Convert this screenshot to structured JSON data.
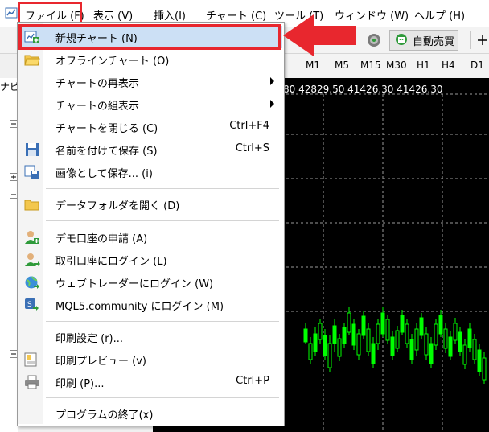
{
  "menubar": {
    "items": [
      "ファイル (F)",
      "表示 (V)",
      "挿入(I)",
      "チャート (C)",
      "ツール (T)",
      "ウィンドウ (W)",
      "ヘルプ (H)"
    ]
  },
  "toolbar": {
    "autotrade_label": "自動売買"
  },
  "timeframes": [
    "M1",
    "M5",
    "M15",
    "M30",
    "H1",
    "H4",
    "D1"
  ],
  "panel_title": "ナビ",
  "chart": {
    "price_text": "80 42829.50 41426.30 41426.30"
  },
  "dropdown": {
    "items": [
      {
        "label": "新規チャート (N)",
        "icon": "new-chart-icon",
        "shortcut": ""
      },
      {
        "label": "オフラインチャート (O)",
        "icon": "open-folder-icon",
        "shortcut": ""
      },
      {
        "label": "チャートの再表示",
        "icon": "",
        "shortcut": "",
        "submenu": true
      },
      {
        "label": "チャートの組表示",
        "icon": "",
        "shortcut": "",
        "submenu": true
      },
      {
        "label": "チャートを閉じる (C)",
        "icon": "",
        "shortcut": "Ctrl+F4"
      },
      {
        "label": "名前を付けて保存 (S)",
        "icon": "save-icon",
        "shortcut": "Ctrl+S"
      },
      {
        "label": "画像として保存... (i)",
        "icon": "save-picture-icon",
        "shortcut": ""
      },
      {
        "label": "データフォルダを開く (D)",
        "icon": "folder-icon",
        "shortcut": ""
      },
      {
        "label": "デモ口座の申請 (A)",
        "icon": "add-account-icon",
        "shortcut": ""
      },
      {
        "label": "取引口座にログイン (L)",
        "icon": "login-account-icon",
        "shortcut": ""
      },
      {
        "label": "ウェブトレーダーにログイン (W)",
        "icon": "web-trader-icon",
        "shortcut": ""
      },
      {
        "label": "MQL5.community にログイン (M)",
        "icon": "mql5-icon",
        "shortcut": ""
      },
      {
        "label": "印刷設定 (r)...",
        "icon": "",
        "shortcut": ""
      },
      {
        "label": "印刷プレビュー (v)",
        "icon": "print-preview-icon",
        "shortcut": ""
      },
      {
        "label": "印刷 (P)...",
        "icon": "printer-icon",
        "shortcut": "Ctrl+P"
      },
      {
        "label": "プログラムの終了(x)",
        "icon": "",
        "shortcut": ""
      }
    ]
  },
  "colors": {
    "highlight_box": "#e8272e",
    "menu_highlight": "#cce0f5",
    "candle_green": "#00ff00"
  }
}
